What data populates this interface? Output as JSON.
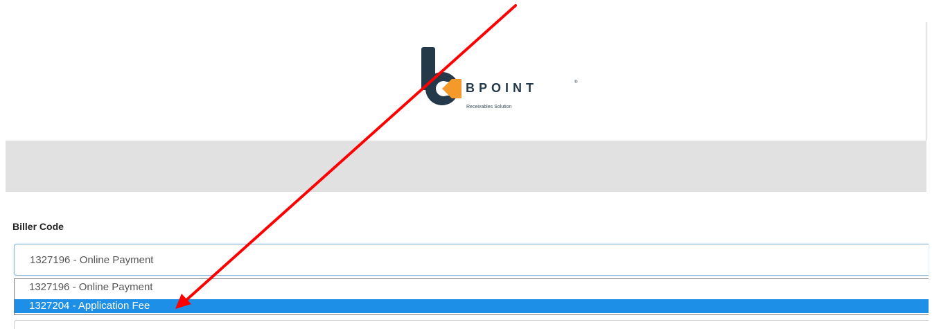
{
  "brand": {
    "name": "BPOINT",
    "trademark": "®",
    "tagline": "Receivables Solution",
    "colors": {
      "navy": "#243a4a",
      "orange": "#f39a2a"
    }
  },
  "form": {
    "biller_code_label": "Biller Code",
    "biller_code_selected": "1327196 - Online Payment",
    "biller_code_options": [
      "1327196 - Online Payment",
      "1327204 - Application Fee"
    ],
    "highlighted_option_index": 1
  },
  "colors": {
    "banner": "#e1e1e1",
    "highlight": "#1e8fe6",
    "annotation_arrow": "#ff0000"
  },
  "annotation": {
    "type": "red-arrow",
    "points_to": "1327204 - Application Fee"
  }
}
